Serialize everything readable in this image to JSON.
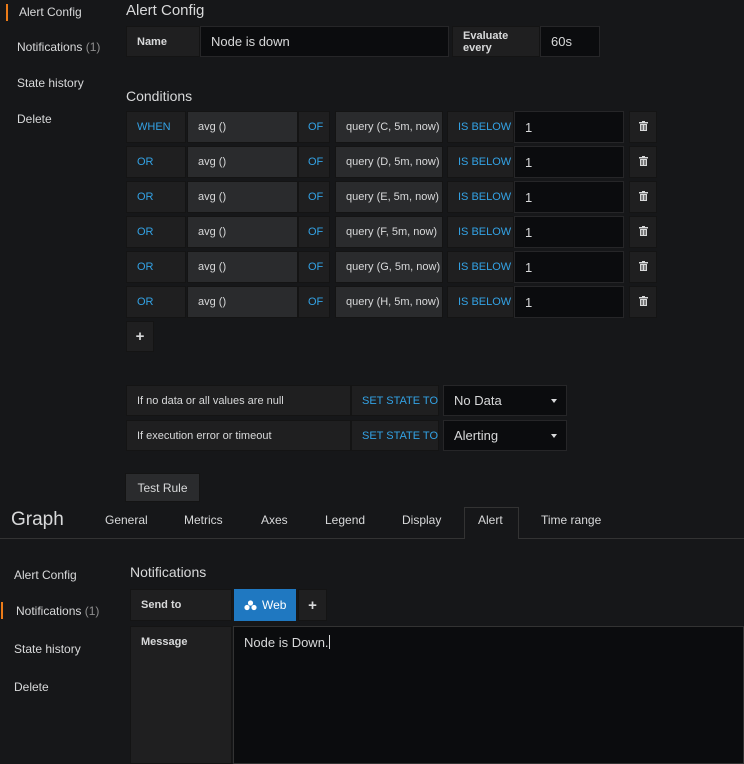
{
  "top": {
    "sidebar": [
      {
        "label": "Alert Config",
        "count": ""
      },
      {
        "label": "Notifications",
        "count": "(1)"
      },
      {
        "label": "State history",
        "count": ""
      },
      {
        "label": "Delete",
        "count": ""
      }
    ],
    "title": "Alert Config",
    "name_label": "Name",
    "name_value": "Node is down",
    "eval_label": "Evaluate every",
    "eval_value": "60s",
    "conditions_title": "Conditions",
    "conditions": [
      {
        "op": "WHEN",
        "func": "avg ()",
        "of": "OF",
        "query": "query (C, 5m, now)",
        "cmp": "IS BELOW",
        "value": "1"
      },
      {
        "op": "OR",
        "func": "avg ()",
        "of": "OF",
        "query": "query (D, 5m, now)",
        "cmp": "IS BELOW",
        "value": "1"
      },
      {
        "op": "OR",
        "func": "avg ()",
        "of": "OF",
        "query": "query (E, 5m, now)",
        "cmp": "IS BELOW",
        "value": "1"
      },
      {
        "op": "OR",
        "func": "avg ()",
        "of": "OF",
        "query": "query (F, 5m, now)",
        "cmp": "IS BELOW",
        "value": "1"
      },
      {
        "op": "OR",
        "func": "avg ()",
        "of": "OF",
        "query": "query (G, 5m, now)",
        "cmp": "IS BELOW",
        "value": "1"
      },
      {
        "op": "OR",
        "func": "avg ()",
        "of": "OF",
        "query": "query (H, 5m, now)",
        "cmp": "IS BELOW",
        "value": "1"
      }
    ],
    "add_label": "+",
    "nodata_label": "If no data or all values are null",
    "error_label": "If execution error or timeout",
    "set_state_label": "SET STATE TO",
    "nodata_value": "No Data",
    "error_value": "Alerting",
    "test_rule": "Test Rule"
  },
  "bottom": {
    "title": "Graph",
    "tabs": [
      "General",
      "Metrics",
      "Axes",
      "Legend",
      "Display",
      "Alert",
      "Time range"
    ],
    "active_tab": "Alert",
    "sidebar": [
      {
        "label": "Alert Config",
        "count": ""
      },
      {
        "label": "Notifications",
        "count": "(1)"
      },
      {
        "label": "State history",
        "count": ""
      },
      {
        "label": "Delete",
        "count": ""
      }
    ],
    "notifications_title": "Notifications",
    "send_to_label": "Send to",
    "channel_label": "Web",
    "add_label": "+",
    "message_label": "Message",
    "message_value": "Node is Down."
  },
  "colors": {
    "accent": "#eb7b18",
    "keyword": "#33a2e5",
    "channel": "#1f78c1"
  },
  "icons": {
    "delete": "trash-icon",
    "channel": "channel-icon",
    "dropdown": "caret-down-icon"
  }
}
